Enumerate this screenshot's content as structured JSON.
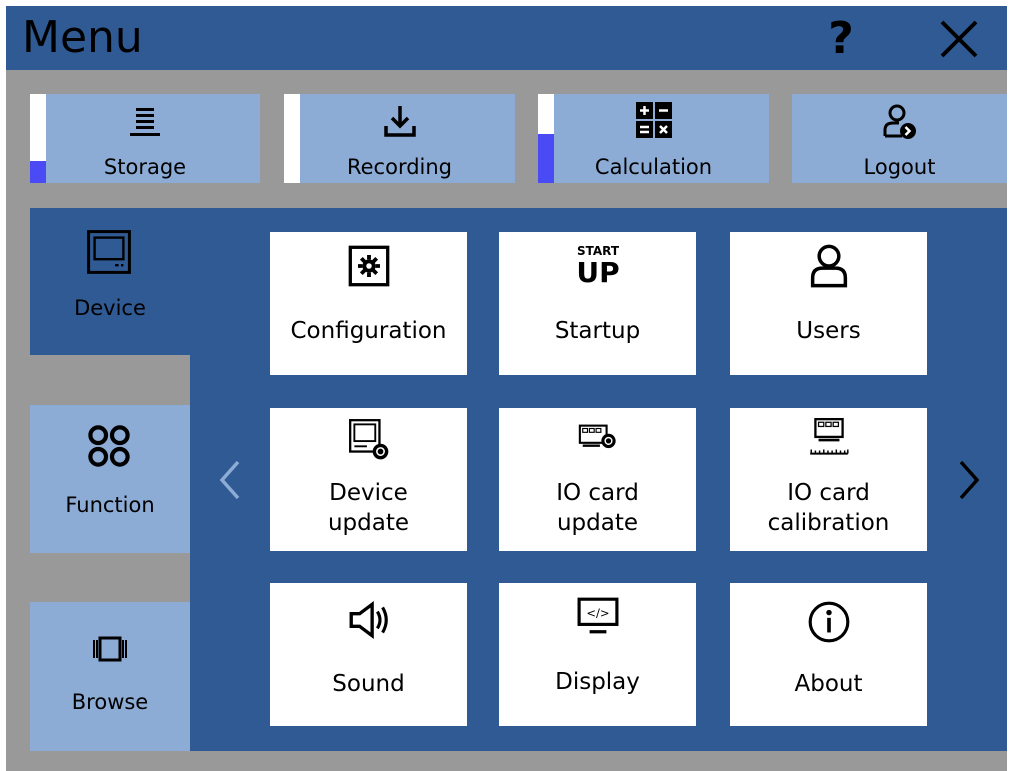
{
  "header": {
    "title": "Menu",
    "help_glyph": "?",
    "help_icon": "help-icon",
    "close_icon": "close-icon"
  },
  "top_buttons": {
    "storage": {
      "label": "Storage",
      "icon": "storage-stack-icon",
      "meter_level": 0.25
    },
    "recording": {
      "label": "Recording",
      "icon": "download-icon",
      "meter_level": 0.0
    },
    "calculation": {
      "label": "Calculation",
      "icon": "calculator-icon",
      "meter_level": 0.55
    },
    "logout": {
      "label": "Logout",
      "icon": "logout-user-icon"
    }
  },
  "sidebar": {
    "items": [
      {
        "label": "Device",
        "icon": "device-icon",
        "active": true
      },
      {
        "label": "Function",
        "icon": "function-icon",
        "active": false
      },
      {
        "label": "Browse",
        "icon": "browse-icon",
        "active": false
      }
    ]
  },
  "tiles": [
    {
      "label": "Configuration",
      "icon": "settings-gear-icon"
    },
    {
      "label": "Startup",
      "icon": "startup-icon",
      "icon_text_top": "START",
      "icon_text_bottom": "UP"
    },
    {
      "label": "Users",
      "icon": "user-icon"
    },
    {
      "label_line1": "Device",
      "label_line2": "update",
      "icon": "device-update-icon"
    },
    {
      "label_line1": "IO card",
      "label_line2": "update",
      "icon": "io-card-update-icon"
    },
    {
      "label_line1": "IO card",
      "label_line2": "calibration",
      "icon": "io-card-calibration-icon"
    },
    {
      "label": "Sound",
      "icon": "speaker-icon"
    },
    {
      "label": "Display",
      "icon": "display-code-icon",
      "icon_text": "</>"
    },
    {
      "label": "About",
      "icon": "info-icon"
    }
  ],
  "nav": {
    "prev_icon": "chevron-left-icon",
    "next_icon": "chevron-right-icon"
  },
  "colors": {
    "primary": "#305a94",
    "light": "#8cabd5",
    "background": "#999999",
    "meter": "#4b4bf5",
    "tile": "#ffffff"
  }
}
